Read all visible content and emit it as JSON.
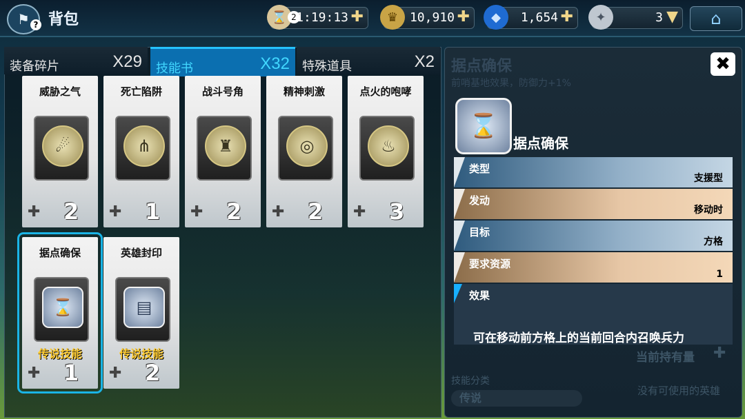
{
  "header": {
    "title": "背包",
    "help_badge": "?",
    "timer": {
      "badge": "2",
      "value": "1:19:13",
      "icon": "hourglass-icon"
    },
    "gold": {
      "value": "10,910",
      "icon": "coin-icon"
    },
    "gems": {
      "value": "1,654",
      "icon": "gem-icon"
    },
    "crystal": {
      "value": "3",
      "icon": "crystal-icon"
    },
    "plus": "✚",
    "dropdown": "▼",
    "home_icon": "home-icon"
  },
  "tabs": [
    {
      "label": "装备碎片",
      "count": "X29"
    },
    {
      "label": "技能书",
      "count": "X32"
    },
    {
      "label": "特殊道具",
      "count": "X2"
    }
  ],
  "cards": [
    {
      "name": "威胁之气",
      "count": "2",
      "icon": "roar-icon",
      "legend": ""
    },
    {
      "name": "死亡陷阱",
      "count": "1",
      "icon": "trap-icon",
      "legend": ""
    },
    {
      "name": "战斗号角",
      "count": "2",
      "icon": "horn-icon",
      "legend": ""
    },
    {
      "name": "精神刺激",
      "count": "2",
      "icon": "drum-icon",
      "legend": ""
    },
    {
      "name": "点火的咆哮",
      "count": "3",
      "icon": "fire-icon",
      "legend": ""
    },
    {
      "name": "据点确保",
      "count": "1",
      "icon": "hourglass-icon",
      "legend": "传说技能"
    },
    {
      "name": "英雄封印",
      "count": "2",
      "icon": "seal-icon",
      "legend": "传说技能"
    }
  ],
  "detail": {
    "ghost_title": "据点确保",
    "ghost_sub": "前哨基地效果，防御力+1%",
    "name": "据点确保",
    "close": "✖",
    "rows": [
      {
        "key": "类型",
        "value": "支援型",
        "color": "blue"
      },
      {
        "key": "发动",
        "value": "移动时",
        "color": "tan"
      },
      {
        "key": "目标",
        "value": "方格",
        "color": "blue"
      },
      {
        "key": "要求资源",
        "value": "1",
        "color": "tan"
      }
    ],
    "effect_label": "效果",
    "effect_text": "可在移动前方格上的当前回合内召唤兵力",
    "ghost_owned": "当前持有量",
    "ghost_category": "技能分类",
    "ghost_chip": "传说",
    "ghost_none": "没有可使用的英雄"
  }
}
